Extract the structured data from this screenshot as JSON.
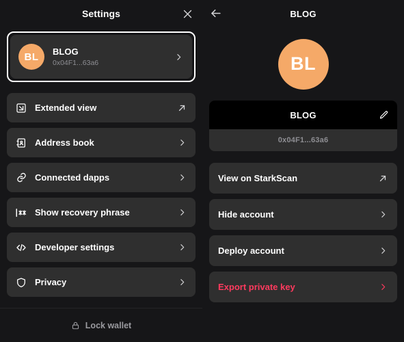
{
  "theme": {
    "background": "#161618",
    "card": "#2f2f2f",
    "accent_avatar": "#f5a968",
    "text_primary": "#ffffff",
    "text_muted": "#8e8e93",
    "danger": "#ff3a5e",
    "focus_ring": "#ffffff",
    "name_row_background": "#000000"
  },
  "settings_panel": {
    "title": "Settings",
    "close_icon": "close-icon",
    "account": {
      "initials": "BL",
      "name": "BLOG",
      "address": "0x04F1...63a6",
      "chevron_icon": "chevron-right-icon",
      "selected": true
    },
    "menu": [
      {
        "label": "Extended view",
        "icon": "extended-view-icon",
        "trailing_icon": "external-link-icon"
      },
      {
        "label": "Address book",
        "icon": "address-book-icon",
        "trailing_icon": "chevron-right-icon"
      },
      {
        "label": "Connected dapps",
        "icon": "link-icon",
        "trailing_icon": "chevron-right-icon"
      },
      {
        "label": "Show recovery phrase",
        "icon": "password-icon",
        "trailing_icon": "chevron-right-icon"
      },
      {
        "label": "Developer settings",
        "icon": "code-icon",
        "trailing_icon": "chevron-right-icon"
      },
      {
        "label": "Privacy",
        "icon": "shield-icon",
        "trailing_icon": "chevron-right-icon"
      }
    ],
    "footer": {
      "lock_label": "Lock wallet",
      "lock_icon": "lock-icon"
    }
  },
  "account_panel": {
    "title": "BLOG",
    "back_icon": "arrow-left-icon",
    "avatar": {
      "initials": "BL"
    },
    "info": {
      "name": "BLOG",
      "edit_icon": "pencil-icon",
      "address": "0x04F1...63a6"
    },
    "actions": [
      {
        "label": "View on StarkScan",
        "trailing_icon": "external-link-icon",
        "danger": false
      },
      {
        "label": "Hide account",
        "trailing_icon": "chevron-right-icon",
        "danger": false
      },
      {
        "label": "Deploy account",
        "trailing_icon": "chevron-right-icon",
        "danger": false
      },
      {
        "label": "Export private key",
        "trailing_icon": "chevron-right-icon",
        "danger": true
      }
    ]
  }
}
